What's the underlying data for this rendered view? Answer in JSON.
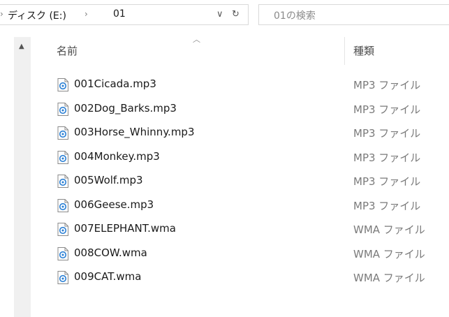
{
  "address_bar": {
    "path": [
      {
        "label": "ディスク (E:)"
      },
      {
        "label": "01"
      }
    ]
  },
  "search": {
    "placeholder": "01の検索"
  },
  "columns": {
    "name": "名前",
    "type": "種類"
  },
  "files": [
    {
      "name": "001Cicada.mp3",
      "type": "MP3 ファイル"
    },
    {
      "name": "002Dog_Barks.mp3",
      "type": "MP3 ファイル"
    },
    {
      "name": "003Horse_Whinny.mp3",
      "type": "MP3 ファイル"
    },
    {
      "name": "004Monkey.mp3",
      "type": "MP3 ファイル"
    },
    {
      "name": "005Wolf.mp3",
      "type": "MP3 ファイル"
    },
    {
      "name": "006Geese.mp3",
      "type": "MP3 ファイル"
    },
    {
      "name": "007ELEPHANT.wma",
      "type": "WMA ファイル"
    },
    {
      "name": "008COW.wma",
      "type": "WMA ファイル"
    },
    {
      "name": "009CAT.wma",
      "type": "WMA ファイル"
    }
  ],
  "icons": {
    "file_icon": "audio-file-icon",
    "accent": "#2a7fd4"
  }
}
